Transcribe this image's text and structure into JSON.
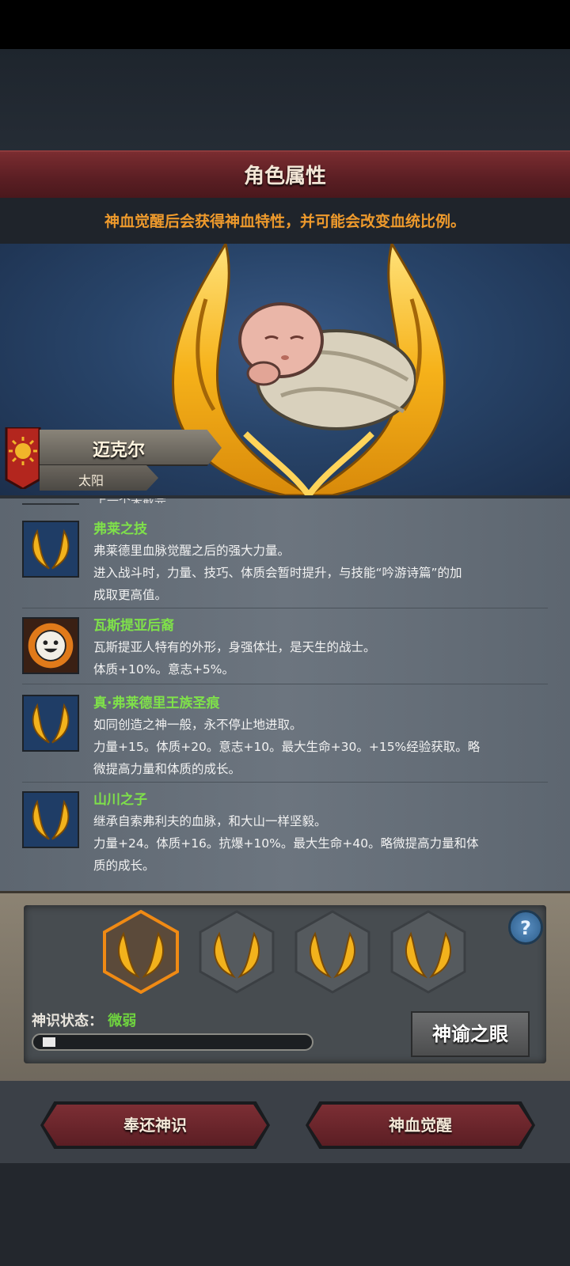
{
  "header": {
    "title": "角色属性"
  },
  "subtitle": "神血觉醒后会获得神血特性，并可能会改变血统比例。",
  "character": {
    "name": "迈克尔",
    "faction": "太阳"
  },
  "list": {
    "cut_off_text": "上一个未截完",
    "traits": [
      {
        "name": "弗莱之技",
        "icon": "golden-wings-icon",
        "lines": [
          "弗莱德里血脉觉醒之后的强大力量。",
          "进入战斗时，力量、技巧、体质会暂时提升，与技能“吟游诗篇”的加",
          "成取更高值。"
        ]
      },
      {
        "name": "瓦斯提亚后裔",
        "icon": "smiley-sun-icon",
        "lines": [
          "瓦斯提亚人特有的外形，身强体壮，是天生的战士。",
          "体质+10%。意志+5%。"
        ]
      },
      {
        "name": "真·弗莱德里王族圣痕",
        "icon": "golden-wings-icon",
        "lines": [
          "如同创造之神一般，永不停止地进取。",
          "力量+15。体质+20。意志+10。最大生命+30。+15%经验获取。略",
          "微提高力量和体质的成长。"
        ]
      },
      {
        "name": "山川之子",
        "icon": "golden-wings-icon",
        "lines": [
          "继承自索弗利夫的血脉，和大山一样坚毅。",
          "力量+24。体质+16。抗爆+10%。最大生命+40。略微提高力量和体",
          "质的成长。"
        ]
      }
    ]
  },
  "bottom": {
    "status_label": "神识状态：",
    "status_value": "微弱",
    "progress": 0.05,
    "oracle_button": "神谕之眼",
    "help_label": "?"
  },
  "actions": {
    "return_button": "奉还神识",
    "awaken_button": "神血觉醒"
  },
  "colors": {
    "accent_orange": "#ee9a2c",
    "trait_green": "#7fe14a",
    "header_red": "#6a2428",
    "wing_gold": "#f2b21c"
  }
}
